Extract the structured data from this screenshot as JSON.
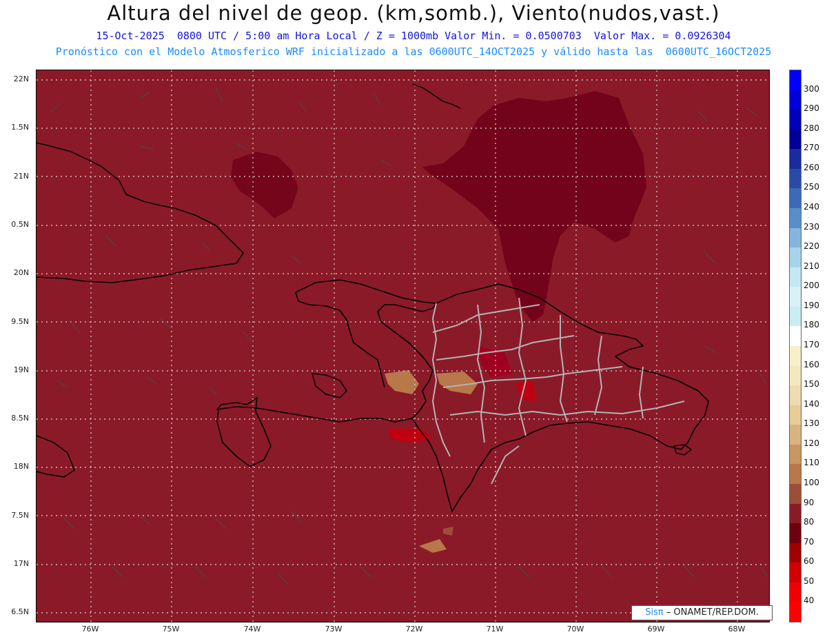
{
  "header": {
    "title": "Altura del nivel de geop. (km,somb.), Viento(nudos,vast.)",
    "subtitle_line1": "15-Oct-2025  0800 UTC / 5:00 am Hora Local / Z = 1000mb Valor Min. = 0.0500703  Valor Max. = 0.0926304",
    "subtitle_line2": "Pronóstico con el Modelo Atmosferico WRF inicializado a las 0600UTC_14OCT2025 y válido hasta las  0600UTC_16OCT2025"
  },
  "map": {
    "background_color": "#8b1a28",
    "lat_labels": [
      "22N",
      "1.5N",
      "21N",
      "0.5N",
      "20N",
      "9.5N",
      "19N",
      "8.5N",
      "18N",
      "7.5N",
      "17N",
      "6.5N"
    ],
    "lon_labels": [
      "76W",
      "75W",
      "74W",
      "73W",
      "72W",
      "71W",
      "70W",
      "69W",
      "68W"
    ]
  },
  "colorbar": {
    "levels": [
      {
        "label": "300",
        "color": "#0000ff"
      },
      {
        "label": "290",
        "color": "#0000d8"
      },
      {
        "label": "280",
        "color": "#0000b8"
      },
      {
        "label": "270",
        "color": "#000098"
      },
      {
        "label": "260",
        "color": "#1a2c9c"
      },
      {
        "label": "250",
        "color": "#2a4aa8"
      },
      {
        "label": "240",
        "color": "#3c6ab8"
      },
      {
        "label": "230",
        "color": "#5a8ec8"
      },
      {
        "label": "220",
        "color": "#86b4dc"
      },
      {
        "label": "210",
        "color": "#a8d4ea"
      },
      {
        "label": "200",
        "color": "#c4e8f4"
      },
      {
        "label": "190",
        "color": "#d8f0f8"
      },
      {
        "label": "180",
        "color": "#c8eef4"
      },
      {
        "label": "170",
        "color": "#ffffff"
      },
      {
        "label": "160",
        "color": "#f8f0c8"
      },
      {
        "label": "150",
        "color": "#f4e8c0"
      },
      {
        "label": "140",
        "color": "#eedcb0"
      },
      {
        "label": "130",
        "color": "#e8cc98"
      },
      {
        "label": "120",
        "color": "#d8b480"
      },
      {
        "label": "110",
        "color": "#c89660"
      },
      {
        "label": "100",
        "color": "#b8784a"
      },
      {
        "label": "90",
        "color": "#9c4e38"
      },
      {
        "label": "80",
        "color": "#8b1a28"
      },
      {
        "label": "70",
        "color": "#6e0010"
      },
      {
        "label": "60",
        "color": "#a00000"
      },
      {
        "label": "50",
        "color": "#d00000"
      },
      {
        "label": "40",
        "color": "#f00000"
      },
      {
        "label": "",
        "color": "#ff0000"
      }
    ]
  },
  "credit": {
    "sis": "Sisπ",
    "text": "–  ONAMET/REP.DOM."
  }
}
